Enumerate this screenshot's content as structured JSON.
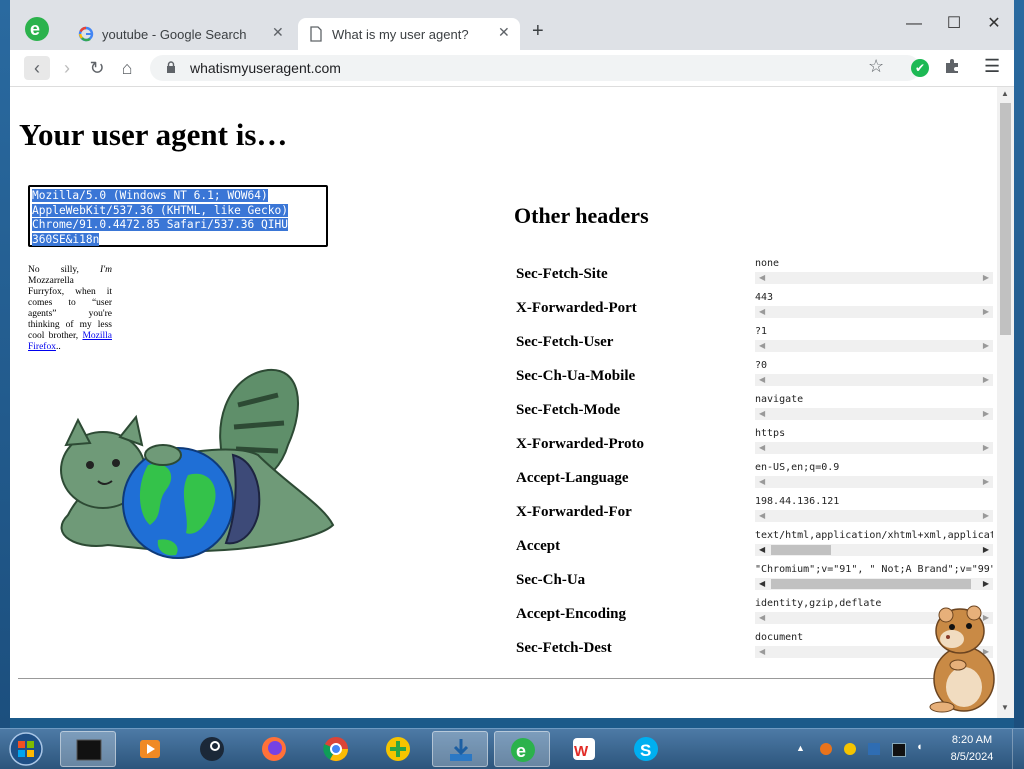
{
  "browser": {
    "tabs": [
      {
        "label": "youtube - Google Search",
        "icon": "google-g-icon",
        "active": false
      },
      {
        "label": "What is my user agent?",
        "icon": "page-icon",
        "active": true
      }
    ],
    "url": "whatismyuseragent.com",
    "window_controls": {
      "minimize": "—",
      "maximize": "☐",
      "close": "✕"
    }
  },
  "page": {
    "heading": "Your user agent is…",
    "user_agent": "Mozilla/5.0 (Windows NT 6.1; WOW64) AppleWebKit/537.36 (KHTML, like Gecko) Chrome/91.0.4472.85 Safari/537.36 QIHU 360SE&i18n",
    "ua_lines": [
      "Mozilla/5.0 (Windows NT 6.1; WOW64)",
      "AppleWebKit/537.36 (KHTML, like Gecko)",
      "Chrome/91.0.4472.85 Safari/537.36 QIHU",
      "360SE&i18n"
    ],
    "silly_text_a": "No silly, ",
    "silly_text_im": "I'm",
    "silly_text_b": " Mozzarrella Furryfox, when it comes to “user agents” you're thinking of my less cool brother, ",
    "silly_link": "Mozilla Firefox",
    "silly_end": "..",
    "other_heading": "Other headers",
    "headers": [
      {
        "name": "Sec-Fetch-Site",
        "value": "none"
      },
      {
        "name": "X-Forwarded-Port",
        "value": "443"
      },
      {
        "name": "Sec-Fetch-User",
        "value": "?1"
      },
      {
        "name": "Sec-Ch-Ua-Mobile",
        "value": "?0"
      },
      {
        "name": "Sec-Fetch-Mode",
        "value": "navigate"
      },
      {
        "name": "X-Forwarded-Proto",
        "value": "https"
      },
      {
        "name": "Accept-Language",
        "value": "en-US,en;q=0.9"
      },
      {
        "name": "X-Forwarded-For",
        "value": "198.44.136.121"
      },
      {
        "name": "Accept",
        "value": "text/html,application/xhtml+xml,applicat"
      },
      {
        "name": "Sec-Ch-Ua",
        "value": "\"Chromium\";v=\"91\", \" Not;A Brand\";v=\"99\""
      },
      {
        "name": "Accept-Encoding",
        "value": "identity,gzip,deflate"
      },
      {
        "name": "Sec-Fetch-Dest",
        "value": "document"
      }
    ]
  },
  "taskbar": {
    "apps": [
      "terminal",
      "media-player",
      "steam",
      "firefox",
      "chrome",
      "360-plus",
      "download-manager",
      "ie-browser",
      "wps-office",
      "skype"
    ],
    "clock_time": "8:20 AM",
    "clock_date": "8/5/2024"
  },
  "colors": {
    "selection": "#3a76d6",
    "tab_strip": "#dee1e6",
    "taskbar": "#2c557c"
  }
}
